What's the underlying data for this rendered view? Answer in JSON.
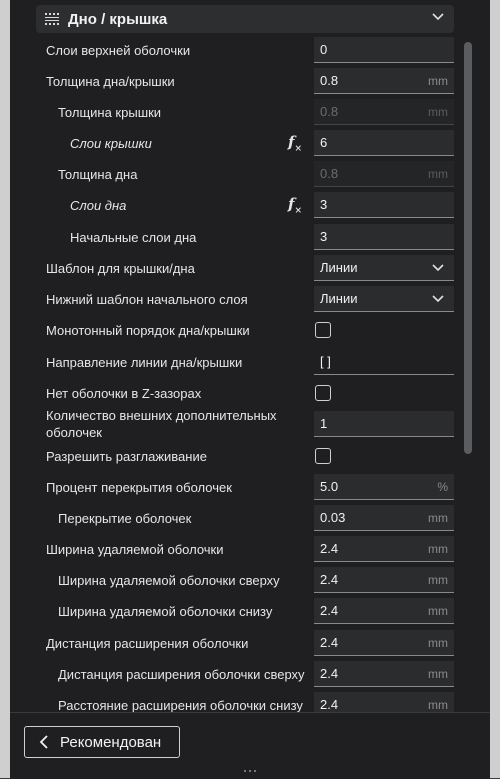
{
  "section": {
    "title": "Дно / крышка"
  },
  "settings": [
    {
      "label": "Слои верхней оболочки",
      "value": "0",
      "unit": "",
      "type": "field"
    },
    {
      "label": "Толщина дна/крышки",
      "value": "0.8",
      "unit": "mm",
      "type": "field"
    },
    {
      "label": "Толщина крышки",
      "value": "0.8",
      "unit": "mm",
      "type": "field-disabled"
    },
    {
      "label": "Слои крышки",
      "value": "6",
      "unit": "",
      "type": "field"
    },
    {
      "label": "Толщина дна",
      "value": "0.8",
      "unit": "mm",
      "type": "field-disabled"
    },
    {
      "label": "Слои дна",
      "value": "3",
      "unit": "",
      "type": "field"
    },
    {
      "label": "Начальные слои дна",
      "value": "3",
      "unit": "",
      "type": "field"
    },
    {
      "label": "Шаблон для крышки/дна",
      "value": "Линии",
      "unit": "",
      "type": "select"
    },
    {
      "label": "Нижний шаблон начального слоя",
      "value": "Линии",
      "unit": "",
      "type": "select"
    },
    {
      "label": "Монотонный порядок дна/крышки",
      "value": "",
      "unit": "",
      "type": "checkbox"
    },
    {
      "label": "Направление линии дна/крышки",
      "value": "[ ]",
      "unit": "",
      "type": "text-plain"
    },
    {
      "label": "Нет оболочки в Z-зазорах",
      "value": "",
      "unit": "",
      "type": "checkbox"
    },
    {
      "label": "Количество внешних дополнительных оболочек",
      "value": "1",
      "unit": "",
      "type": "field"
    },
    {
      "label": "Разрешить разглаживание",
      "value": "",
      "unit": "",
      "type": "checkbox"
    },
    {
      "label": "Процент перекрытия оболочек",
      "value": "5.0",
      "unit": "%",
      "type": "field"
    },
    {
      "label": "Перекрытие оболочек",
      "value": "0.03",
      "unit": "mm",
      "type": "field"
    },
    {
      "label": "Ширина удаляемой оболочки",
      "value": "2.4",
      "unit": "mm",
      "type": "field"
    },
    {
      "label": "Ширина удаляемой оболочки сверху",
      "value": "2.4",
      "unit": "mm",
      "type": "field"
    },
    {
      "label": "Ширина удаляемой оболочки снизу",
      "value": "2.4",
      "unit": "mm",
      "type": "field"
    },
    {
      "label": "Дистанция расширения оболочки",
      "value": "2.4",
      "unit": "mm",
      "type": "field"
    },
    {
      "label": "Дистанция расширения оболочки сверху",
      "value": "2.4",
      "unit": "mm",
      "type": "field"
    },
    {
      "label": "Расстояние расширения оболочки снизу",
      "value": "2.4",
      "unit": "mm",
      "type": "field"
    }
  ],
  "footer": {
    "recommended_label": "Рекомендован"
  }
}
